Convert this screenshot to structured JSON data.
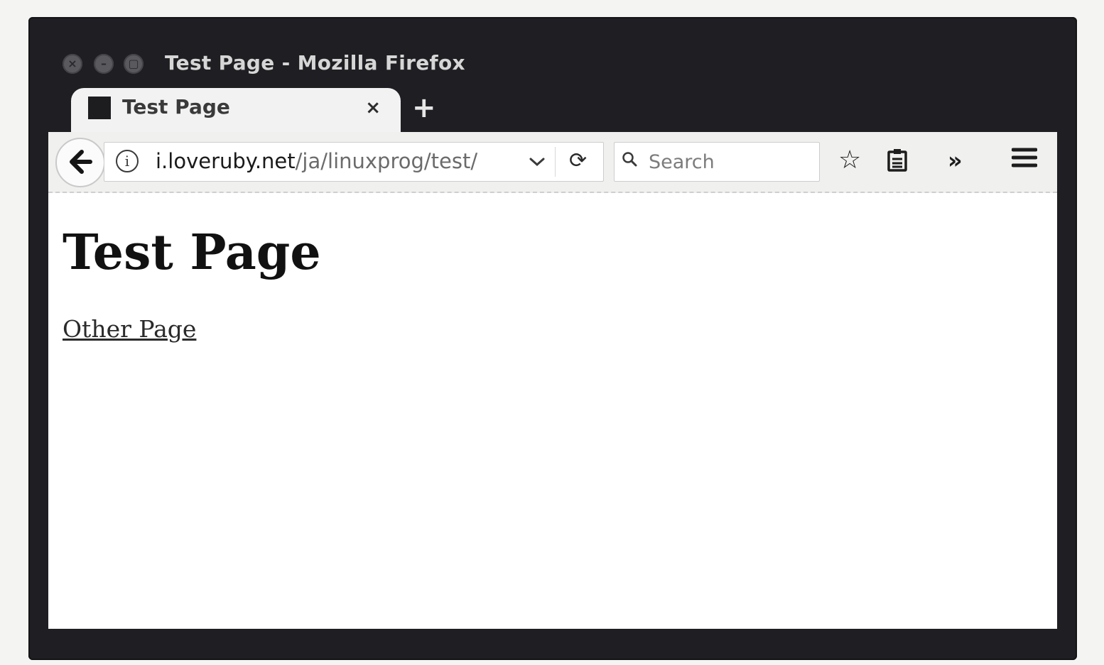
{
  "window": {
    "title": "Test Page - Mozilla Firefox",
    "controls": {
      "close_glyph": "×",
      "minimize_glyph": "–",
      "maximize_glyph": "▢"
    }
  },
  "tabs": [
    {
      "label": "Test Page",
      "close_glyph": "×",
      "active": true
    }
  ],
  "new_tab_glyph": "+",
  "toolbar": {
    "back_glyph": "🡐",
    "info_glyph": "i",
    "url_host": "i.loveruby.net",
    "url_path": "/ja/linuxprog/test/",
    "dropdown_glyph": "⌄",
    "reload_glyph": "⟳",
    "search_placeholder": "Search",
    "bookmark_glyph": "☆",
    "clipboard_glyph": "▤",
    "overflow_glyph": "»",
    "menu_glyph": "≡"
  },
  "page": {
    "heading": "Test Page",
    "link_text": "Other Page"
  },
  "icons": [
    "close-icon",
    "minimize-icon",
    "maximize-icon",
    "favicon",
    "tab-close-icon",
    "plus-icon",
    "back-arrow-icon",
    "info-icon",
    "dropdown-icon",
    "reload-icon",
    "search-icon",
    "star-icon",
    "clipboard-icon",
    "overflow-icon",
    "hamburger-menu-icon"
  ],
  "colors": {
    "window_frame": "#1f1f23",
    "toolbar_bg": "#f0f0ef",
    "page_bg": "#ffffff",
    "title_text": "#d6d6d6"
  }
}
